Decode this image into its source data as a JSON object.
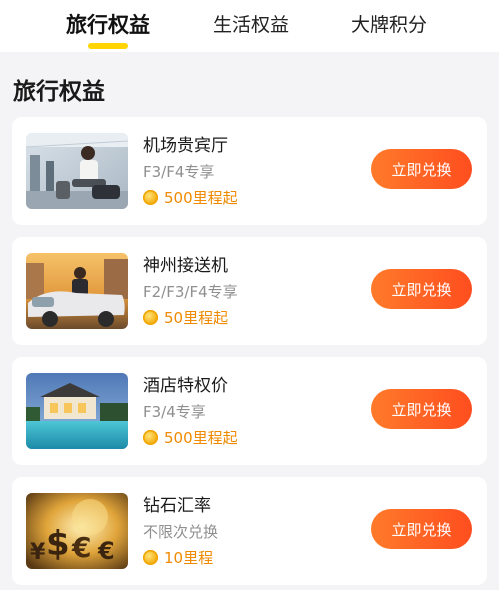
{
  "tabs": [
    {
      "label": "旅行权益",
      "active": true
    },
    {
      "label": "生活权益",
      "active": false
    },
    {
      "label": "大牌积分",
      "active": false
    }
  ],
  "accent_color": "#ffd400",
  "button_color": "#ff5a22",
  "section_title": "旅行权益",
  "cards": [
    {
      "name": "机场贵宾厅",
      "tier": "F3/F4专享",
      "price": "500里程起",
      "button": "立即兑换",
      "image": "airport-lounge-image"
    },
    {
      "name": "神州接送机",
      "tier": "F2/F3/F4专享",
      "price": "50里程起",
      "button": "立即兑换",
      "image": "chauffeur-car-image"
    },
    {
      "name": "酒店特权价",
      "tier": "F3/4专享",
      "price": "500里程起",
      "button": "立即兑换",
      "image": "hotel-pool-image"
    },
    {
      "name": "钻石汇率",
      "tier": "不限次兑换",
      "price": "10里程",
      "button": "立即兑换",
      "image": "currency-symbols-image"
    }
  ]
}
